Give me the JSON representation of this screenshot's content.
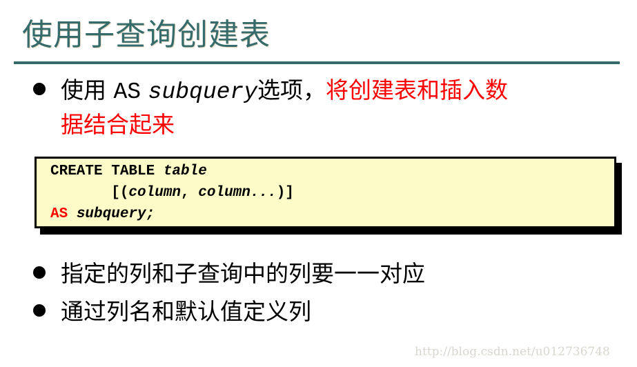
{
  "slide": {
    "title": "使用子查询创建表",
    "bullets": [
      {
        "prefix": "使用",
        "keyword": "AS",
        "param": "subquery",
        "suffix": "选项，",
        "highlight_line1": "将创建表和插入数",
        "highlight_line2": "据结合起来"
      },
      {
        "text": "指定的列和子查询中的列要一一对应"
      },
      {
        "text": "通过列名和默认值定义列"
      }
    ],
    "code": {
      "line1_keyword": "CREATE TABLE ",
      "line1_param": "table",
      "line2_open": "       [(",
      "line2_param1": "column",
      "line2_sep": ", ",
      "line2_param2": "column...",
      "line2_close": ")]",
      "line3_keyword": "AS",
      "line3_space": " ",
      "line3_param": "subquery;"
    },
    "watermark": "http://blog.csdn.net/u012736748",
    "colors": {
      "title": "#356b6b",
      "rule": "#366b6a",
      "highlight": "#ff0000",
      "code_bg": "#fdfbc8"
    }
  }
}
